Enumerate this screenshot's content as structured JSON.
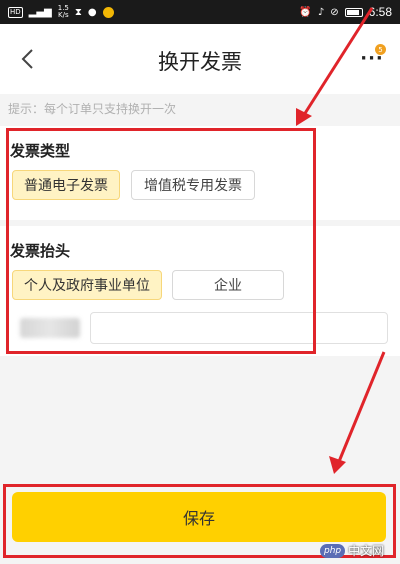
{
  "status_bar": {
    "network": "HD",
    "speed_value": "1.5",
    "speed_unit": "K/s",
    "time": "6:58"
  },
  "header": {
    "title": "换开发票",
    "badge": "5"
  },
  "tip": "提示：每个订单只支持换开一次",
  "invoice_type": {
    "title": "发票类型",
    "options": [
      "普通电子发票",
      "增值税专用发票"
    ],
    "selected": "普通电子发票"
  },
  "invoice_header": {
    "title": "发票抬头",
    "options": [
      "个人及政府事业单位",
      "企业"
    ],
    "selected": "个人及政府事业单位",
    "name_value": ""
  },
  "save_label": "保存",
  "watermark": {
    "logo": "php",
    "text": "中文网"
  },
  "colors": {
    "accent": "#ffd000",
    "selected_chip_bg": "#fff3c4",
    "annotation_red": "#e0242a"
  }
}
